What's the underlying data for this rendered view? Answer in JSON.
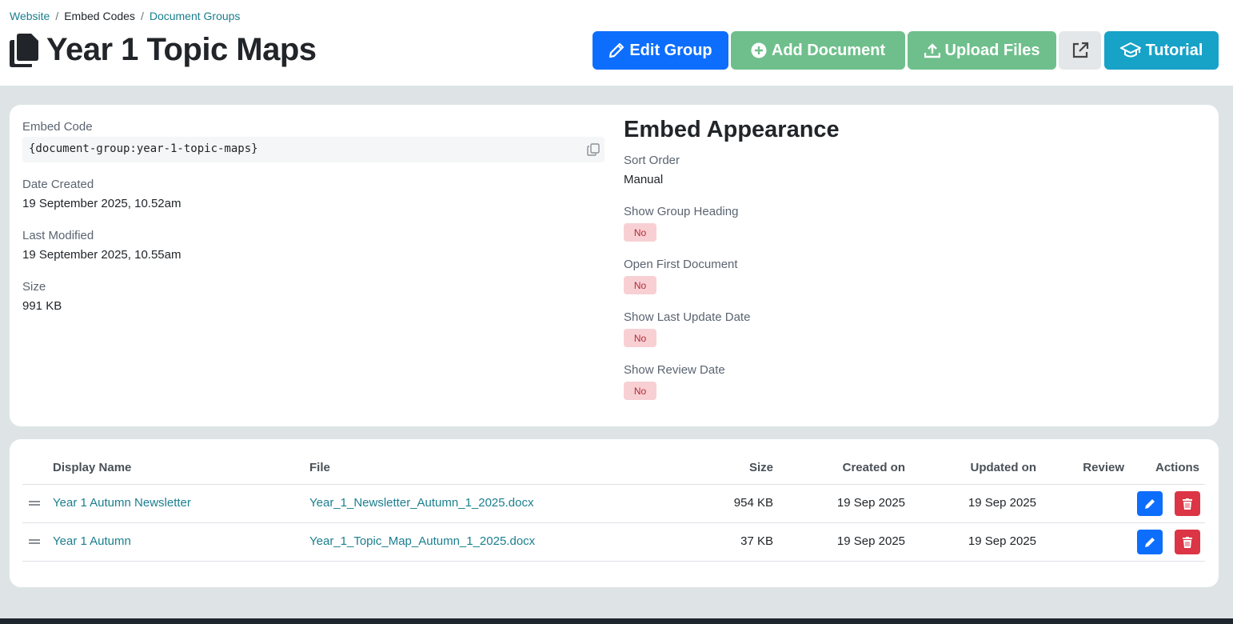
{
  "breadcrumb": {
    "website": "Website",
    "embed_codes": "Embed Codes",
    "document_groups": "Document Groups"
  },
  "page_title": "Year 1 Topic Maps",
  "toolbar": {
    "edit_group": "Edit Group",
    "add_document": "Add Document",
    "upload_files": "Upload Files",
    "tutorial": "Tutorial"
  },
  "info": {
    "embed_code_label": "Embed Code",
    "embed_code": "{document-group:year-1-topic-maps}",
    "date_created_label": "Date Created",
    "date_created": "19 September 2025, 10.52am",
    "last_modified_label": "Last Modified",
    "last_modified": "19 September 2025, 10.55am",
    "size_label": "Size",
    "size": "991 KB"
  },
  "appearance": {
    "title": "Embed Appearance",
    "sort_order_label": "Sort Order",
    "sort_order": "Manual",
    "show_group_heading_label": "Show Group Heading",
    "show_group_heading": "No",
    "open_first_document_label": "Open First Document",
    "open_first_document": "No",
    "show_last_update_label": "Show Last Update Date",
    "show_last_update": "No",
    "show_review_date_label": "Show Review Date",
    "show_review_date": "No"
  },
  "table": {
    "headers": [
      "Display Name",
      "File",
      "Size",
      "Created on",
      "Updated on",
      "Review",
      "Actions"
    ],
    "rows": [
      {
        "name": "Year 1 Autumn Newsletter",
        "file": "Year_1_Newsletter_Autumn_1_2025.docx",
        "size": "954 KB",
        "created": "19 Sep 2025",
        "updated": "19 Sep 2025",
        "review": ""
      },
      {
        "name": "Year 1 Autumn",
        "file": "Year_1_Topic_Map_Autumn_1_2025.docx",
        "size": "37 KB",
        "created": "19 Sep 2025",
        "updated": "19 Sep 2025",
        "review": ""
      }
    ]
  },
  "colors": {
    "primary": "#0d6efd",
    "success": "#6fbf8c",
    "info": "#17a2c8",
    "danger": "#dc3545",
    "link": "#1a7f8e"
  },
  "icons": [
    "documents-icon",
    "pencil-icon",
    "plus-circle-icon",
    "upload-icon",
    "external-link-icon",
    "graduation-cap-icon",
    "copy-icon",
    "drag-handle-icon",
    "trash-icon"
  ]
}
